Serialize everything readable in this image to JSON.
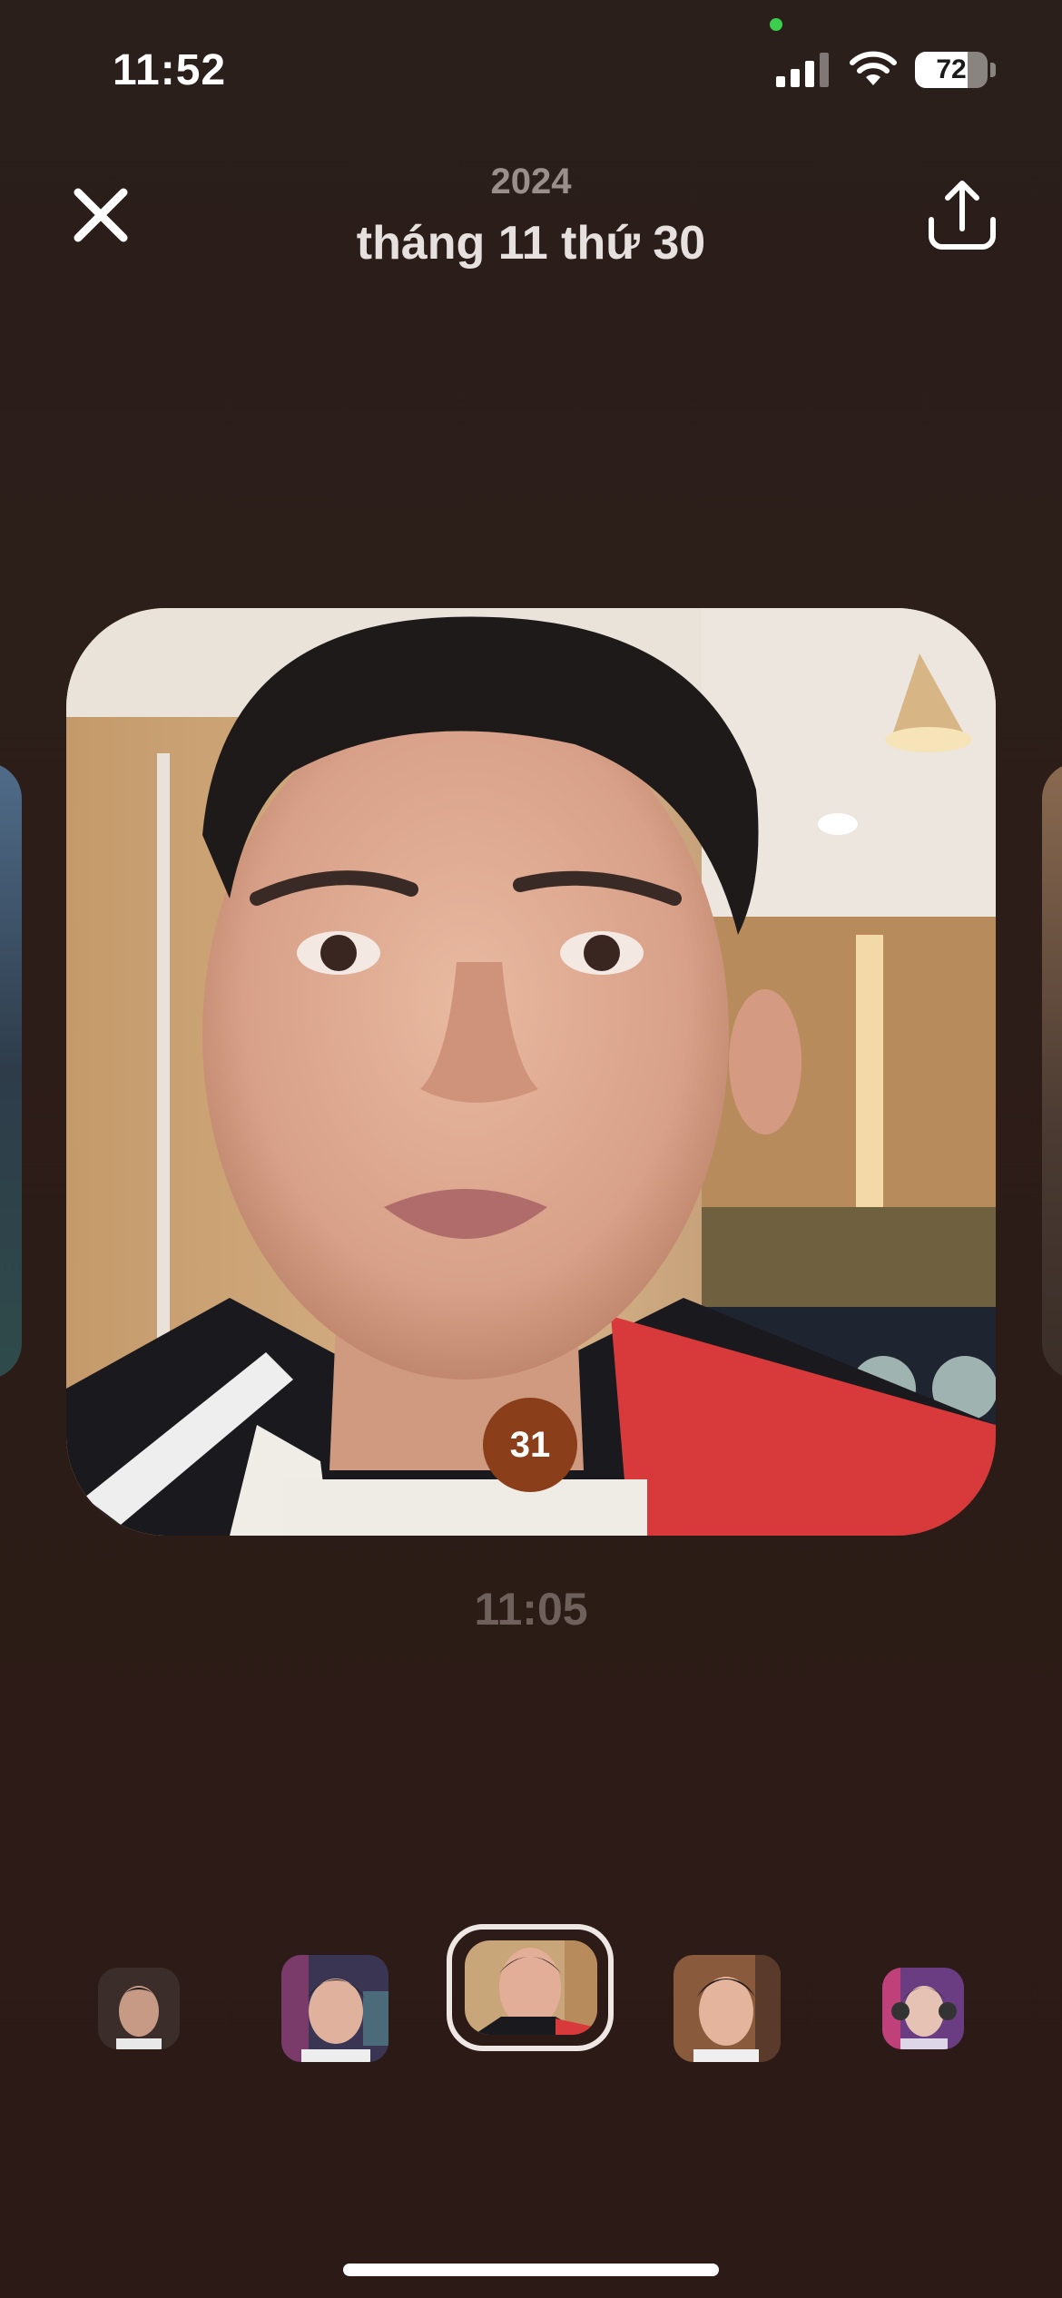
{
  "status_bar": {
    "time": "11:52",
    "battery_level": "72",
    "battery_percent": 72
  },
  "header": {
    "year": "2024",
    "date_title": "tháng 11 thứ 30",
    "close_icon": "close-icon",
    "share_icon": "share-upload-icon"
  },
  "photo": {
    "day_badge": "31",
    "capture_time": "11:05"
  },
  "thumbnails": [
    {
      "label": "photo-thumb-1",
      "selected": false
    },
    {
      "label": "photo-thumb-2",
      "selected": false
    },
    {
      "label": "photo-thumb-3",
      "selected": true
    },
    {
      "label": "photo-thumb-4",
      "selected": false
    },
    {
      "label": "photo-thumb-5",
      "selected": false
    }
  ],
  "colors": {
    "background": "#2b1d19",
    "badge": "#8a3f1a",
    "selected_frame": "#efe7e3",
    "camera_indicator": "#3ccf4e"
  }
}
